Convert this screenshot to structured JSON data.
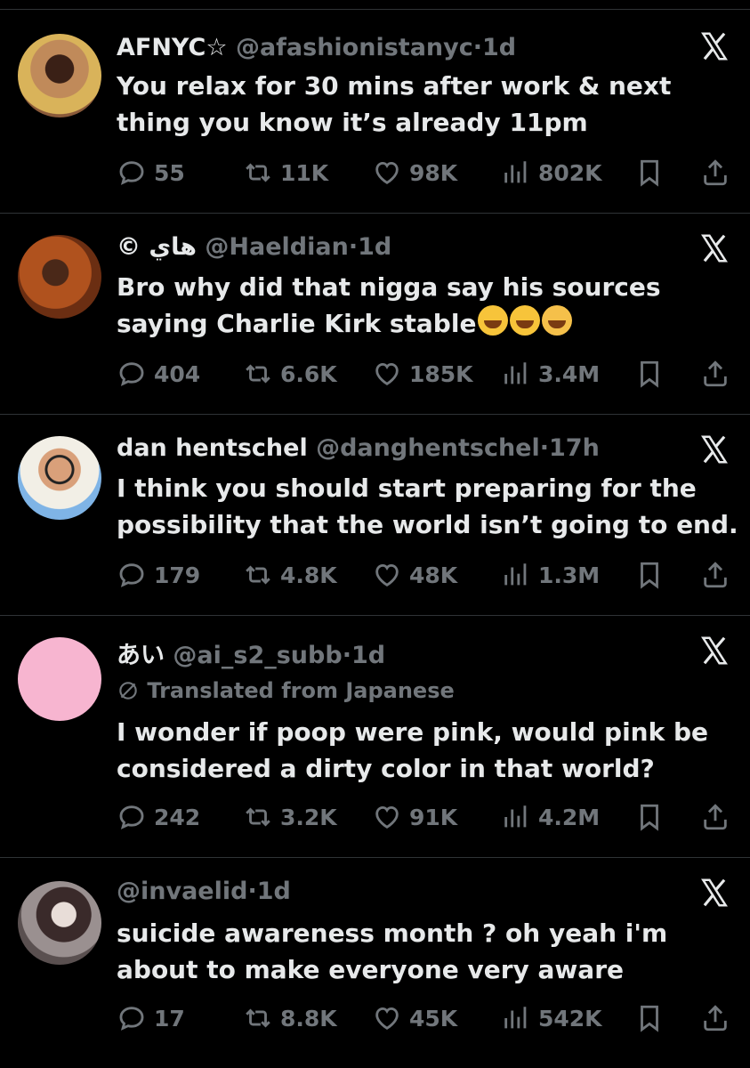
{
  "tweets": [
    {
      "name": "AFNYC☆",
      "handle": "@afashionistanyc",
      "dot": "·",
      "time": "1d",
      "lines": [
        "You relax for 30 mins after work & next",
        "thing you know it’s already 11pm"
      ],
      "replies": "55",
      "reposts": "11K",
      "likes": "98K",
      "views": "802K",
      "avatar_color": "#c08a5a"
    },
    {
      "name": "© هاي",
      "handle": "@Haeldian",
      "dot": "·",
      "time": "1d",
      "lines": [
        "Bro why did that nigga say his sources",
        "saying Charlie Kirk stable"
      ],
      "emoji_count": 3,
      "replies": "404",
      "reposts": "6.6K",
      "likes": "185K",
      "views": "3.4M",
      "avatar_color": "#b0521e"
    },
    {
      "name": "dan hentschel",
      "handle": "@danghentschel",
      "dot": "·",
      "time": "17h",
      "lines": [
        "I think you should start preparing for the",
        "possibility that the world isn’t going to end."
      ],
      "replies": "179",
      "reposts": "4.8K",
      "likes": "48K",
      "views": "1.3M",
      "avatar_color": "#7fb4e6"
    },
    {
      "name": "あい",
      "handle": "@ai_s2_subb",
      "dot": "·",
      "time": "1d",
      "translated": "Translated from Japanese",
      "lines": [
        "I wonder if poop were pink, would pink be",
        "considered a dirty color in that world?"
      ],
      "replies": "242",
      "reposts": "3.2K",
      "likes": "91K",
      "views": "4.2M",
      "avatar_color": "#f7b5d0"
    },
    {
      "name": "",
      "handle": "@invaelid",
      "dot": "·",
      "time": "1d",
      "lines": [
        "suicide awareness month ? oh yeah i'm",
        "about to make everyone very aware"
      ],
      "replies": "17",
      "reposts": "8.8K",
      "likes": "45K",
      "views": "542K",
      "avatar_color": "#8a8a8a"
    }
  ],
  "icons": [
    "x-logo",
    "reply-icon",
    "repost-icon",
    "like-icon",
    "views-icon",
    "bookmark-icon",
    "share-icon",
    "translate-icon"
  ],
  "colors": {
    "background": "#000000",
    "text": "#e7e9ea",
    "muted": "#71767b",
    "divider": "#2f3336"
  }
}
